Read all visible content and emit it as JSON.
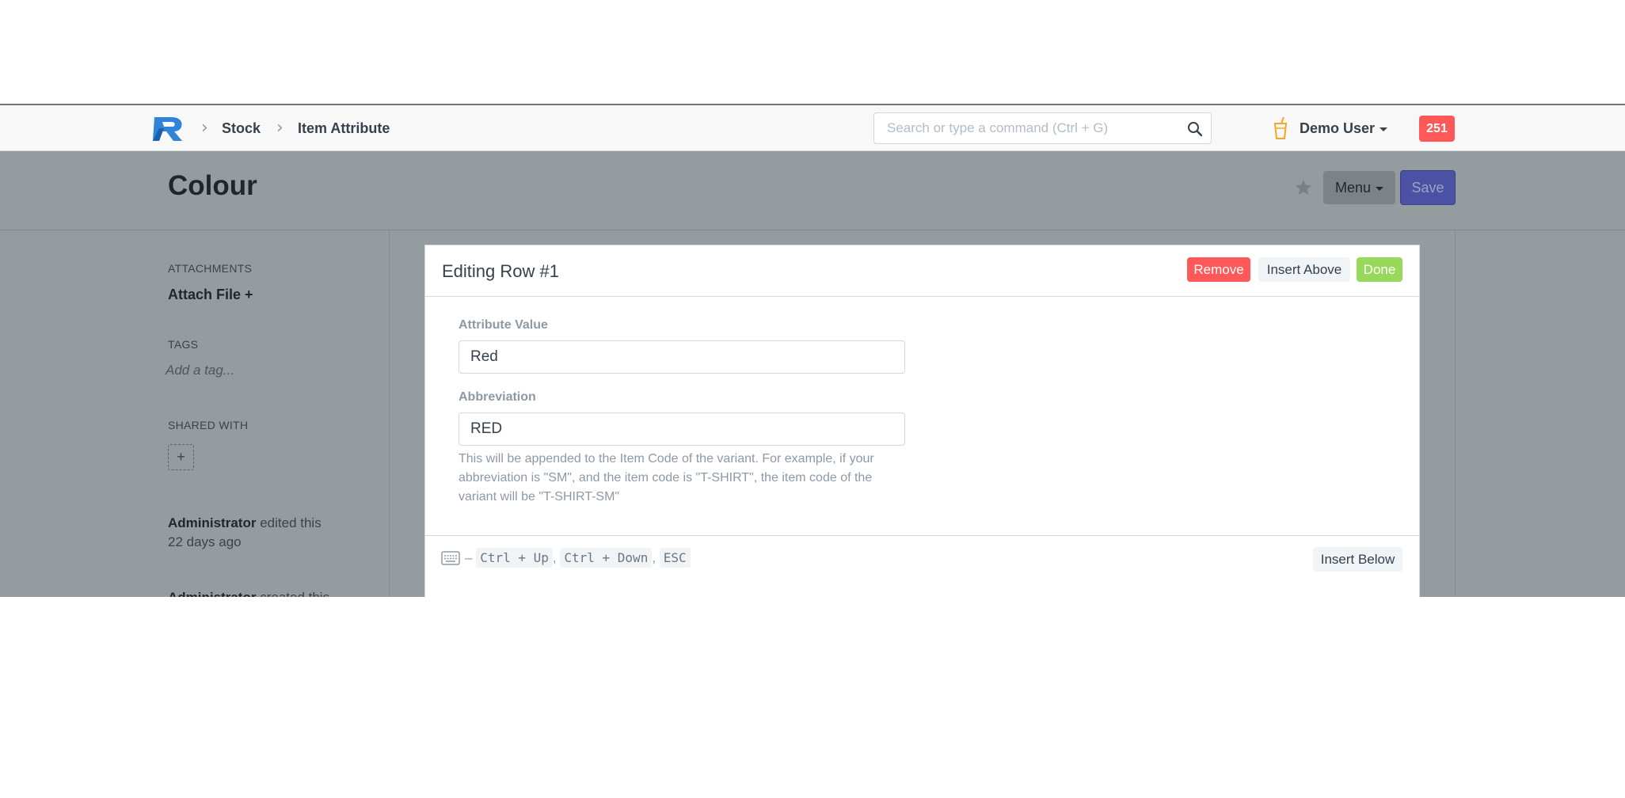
{
  "navbar": {
    "breadcrumbs": [
      "Stock",
      "Item Attribute"
    ],
    "search_placeholder": "Search or type a command (Ctrl + G)",
    "user_name": "Demo User",
    "notification_count": "251"
  },
  "page": {
    "title": "Colour",
    "menu_label": "Menu",
    "save_label": "Save"
  },
  "sidebar": {
    "attachments_label": "ATTACHMENTS",
    "attach_file": "Attach File +",
    "tags_label": "TAGS",
    "add_tag": "Add a tag...",
    "shared_label": "SHARED WITH",
    "shared_add": "+",
    "activity": [
      {
        "user": "Administrator",
        "action": "edited this",
        "time": "22 days ago"
      },
      {
        "user": "Administrator",
        "action": "created this"
      }
    ]
  },
  "modal": {
    "title": "Editing Row #1",
    "remove_label": "Remove",
    "insert_above_label": "Insert Above",
    "done_label": "Done",
    "attribute_value_label": "Attribute Value",
    "attribute_value": "Red",
    "abbreviation_label": "Abbreviation",
    "abbreviation": "RED",
    "help_text": "This will be appended to the Item Code of the variant. For example, if your abbreviation is \"SM\", and the item code is \"T-SHIRT\", the item code of the variant will be \"T-SHIRT-SM\"",
    "shortcut_dash": "–",
    "shortcuts": [
      "Ctrl + Up",
      "Ctrl + Down",
      "ESC"
    ],
    "insert_below_label": "Insert Below"
  },
  "colors": {
    "primary": "#5e64ff",
    "danger": "#ff5858",
    "success": "#98d85b",
    "overlay": "#949c9f"
  },
  "icons": [
    "logo-icon",
    "chevron-right-icon",
    "search-icon",
    "cup-icon",
    "caret-down-icon",
    "star-icon",
    "keyboard-icon"
  ]
}
